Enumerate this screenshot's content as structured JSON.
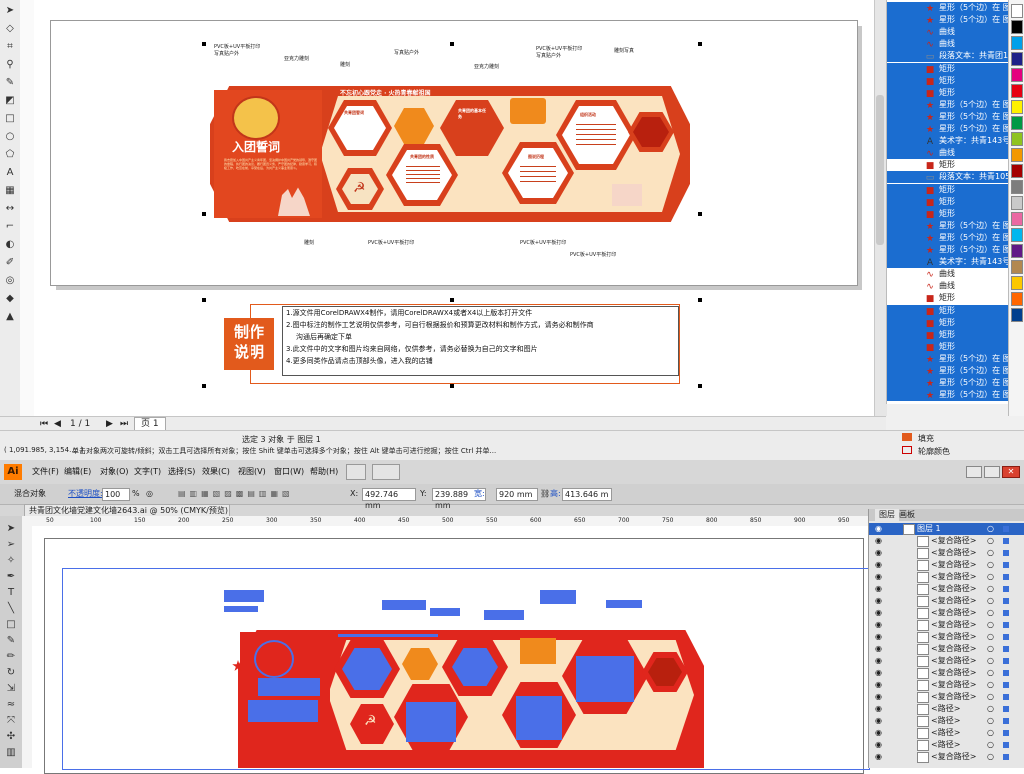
{
  "corel": {
    "sign_board": {
      "join_league_title": "入团誓词",
      "join_league_body": "我志愿加入中国共产主义青年团，坚决拥护中国共产党的领导，遵守团的章程，执行团的决议，履行团员义务，严守团的纪律，勤奋学习，积极工作，吃苦在前，享受在后，为共产主义事业而奋斗。",
      "slogan": "不忘初心跟党走 · 火热青春献祖国",
      "panel_titles": [
        "共青团誓词",
        "共青团的基本任务",
        "共青团的性质",
        "图说历程",
        "组织活动"
      ],
      "callouts": [
        "PVC板+UV平板打印",
        "PVC板+UV平板打印",
        "PVC板+UV平板打印",
        "PVC板+UV平板打印",
        "亚克力雕刻",
        "写真贴户外",
        "雕刻",
        "写真贴户外",
        "亚克力雕刻",
        "PVC板+UV平板打印",
        "雕刻写真",
        "写真贴户外",
        "雕刻"
      ]
    },
    "notes": {
      "badge_line1": "制作",
      "badge_line2": "说明",
      "lines": [
        "1.源文件用CorelDRAWX4制作，请用CorelDRAWX4或者X4以上版本打开文件",
        "2.图中标注的制作工艺说明仅供参考，可自行根据报价和预算更改材料和制作方式，请务必和制作商",
        "沟通后再确定下单",
        "3.此文件中的文字和图片均来自网络，仅供参考，请务必替换为自己的文字和图片",
        "4.更多同类作品请点击顶部头像，进入我的店铺"
      ]
    },
    "objects": [
      {
        "label": "星形（5个边）在 图层",
        "icon": "star",
        "sel": true
      },
      {
        "label": "星形（5个边）在 图层",
        "icon": "star",
        "sel": true
      },
      {
        "label": "曲线",
        "icon": "curve",
        "sel": true
      },
      {
        "label": "曲线",
        "icon": "curve",
        "sel": true
      },
      {
        "label": "段落文本：共青团105号",
        "icon": "text",
        "sel": true
      },
      {
        "label": "矩形",
        "icon": "rect",
        "sel": true
      },
      {
        "label": "矩形",
        "icon": "rect",
        "sel": true
      },
      {
        "label": "矩形",
        "icon": "rect",
        "sel": true
      },
      {
        "label": "星形（5个边）在 图层",
        "icon": "star",
        "sel": true
      },
      {
        "label": "星形（5个边）在 图层",
        "icon": "star",
        "sel": true
      },
      {
        "label": "星形（5个边）在 图层",
        "icon": "star",
        "sel": true
      },
      {
        "label": "美术字：共青143号",
        "icon": "art",
        "sel": true
      },
      {
        "label": "曲线",
        "icon": "curve",
        "sel": true
      },
      {
        "label": "矩形",
        "icon": "rect",
        "sel": false
      },
      {
        "label": "段落文本：共青105号",
        "icon": "text",
        "sel": true
      },
      {
        "label": "矩形",
        "icon": "rect",
        "sel": true
      },
      {
        "label": "矩形",
        "icon": "rect",
        "sel": true
      },
      {
        "label": "矩形",
        "icon": "rect",
        "sel": true
      },
      {
        "label": "星形（5个边）在 图层",
        "icon": "star",
        "sel": true
      },
      {
        "label": "星形（5个边）在 图层",
        "icon": "star",
        "sel": true
      },
      {
        "label": "星形（5个边）在 图层",
        "icon": "star",
        "sel": true
      },
      {
        "label": "美术字：共青143号",
        "icon": "art",
        "sel": true
      },
      {
        "label": "曲线",
        "icon": "curve",
        "sel": false
      },
      {
        "label": "曲线",
        "icon": "curve",
        "sel": false
      },
      {
        "label": "矩形",
        "icon": "rect",
        "sel": false
      },
      {
        "label": "矩形",
        "icon": "rect",
        "sel": true
      },
      {
        "label": "矩形",
        "icon": "rect",
        "sel": true
      },
      {
        "label": "矩形",
        "icon": "rect",
        "sel": true
      },
      {
        "label": "矩形",
        "icon": "rect",
        "sel": true
      },
      {
        "label": "星形（5个边）在 图层",
        "icon": "star",
        "sel": true
      },
      {
        "label": "星形（5个边）在 图层",
        "icon": "star",
        "sel": true
      },
      {
        "label": "星形（5个边）在 图层",
        "icon": "star",
        "sel": true
      },
      {
        "label": "星形（5个边）在 图层",
        "icon": "star",
        "sel": true
      }
    ],
    "palette": [
      "#ffffff",
      "#000000",
      "#00a0e9",
      "#1d2088",
      "#e4007f",
      "#e60012",
      "#fff100",
      "#009944",
      "#8fc31f",
      "#f39800",
      "#a40000",
      "#7d7d7d",
      "#c9c9c9",
      "#ea68a2",
      "#00b7ee",
      "#601986",
      "#b28850",
      "#fcc800",
      "#ff6600",
      "#003f8e"
    ],
    "page_nav": {
      "counter": "1 / 1",
      "page_tab": "页 1"
    },
    "status": {
      "selection": "选定 3 对象 于 图层 1",
      "coords": "( 1,091.985, 3,154.... )",
      "hint": "单击对象两次可旋转/倾斜；双击工具可选择所有对象；按住 Shift 键单击可选择多个对象；按住 Alt 键单击可进行挖掘；按住 Ctrl 并单...",
      "fill_label": "填充",
      "outline_label": "轮廓颜色"
    }
  },
  "ai": {
    "logo": "Ai",
    "menus": [
      "文件(F)",
      "编辑(E)",
      "对象(O)",
      "文字(T)",
      "选择(S)",
      "效果(C)",
      "视图(V)",
      "窗口(W)",
      "帮助(H)"
    ],
    "control": {
      "object_label": "混合对象",
      "opacity_label": "不透明度:",
      "opacity_value": "100",
      "opacity_unit": "%",
      "x_label": "X:",
      "x_value": "492.746 mm",
      "y_label": "Y:",
      "y_value": "239.889 mm",
      "w_label": "宽:",
      "w_value": "920 mm",
      "h_label": "高:",
      "h_value": "413.646 m"
    },
    "doc_tab": "共青团文化墙党建文化墙2643.ai @ 50% (CMYK/预览)",
    "ruler_ticks": [
      "50",
      "100",
      "150",
      "200",
      "250",
      "300",
      "350",
      "400",
      "450",
      "500",
      "550",
      "600",
      "650",
      "700",
      "750",
      "800",
      "850",
      "900",
      "950"
    ],
    "layers": {
      "tab_layers": "图层",
      "tab_artboard": "画板",
      "layer_name": "图层 1",
      "items": [
        "<复合路径>",
        "<复合路径>",
        "<复合路径>",
        "<复合路径>",
        "<复合路径>",
        "<复合路径>",
        "<复合路径>",
        "<复合路径>",
        "<复合路径>",
        "<复合路径>",
        "<复合路径>",
        "<复合路径>",
        "<复合路径>",
        "<复合路径>",
        "<路径>",
        "<路径>",
        "<路径>",
        "<路径>",
        "<复合路径>"
      ]
    }
  },
  "colors": {
    "board_red": "#d8401c",
    "board_orange": "#f08a1c",
    "board_cream": "#fbe3c0",
    "selection_blue": "#1b6dd0",
    "ai_path_blue": "#4a6fe8",
    "ai_red": "#e0261d"
  }
}
